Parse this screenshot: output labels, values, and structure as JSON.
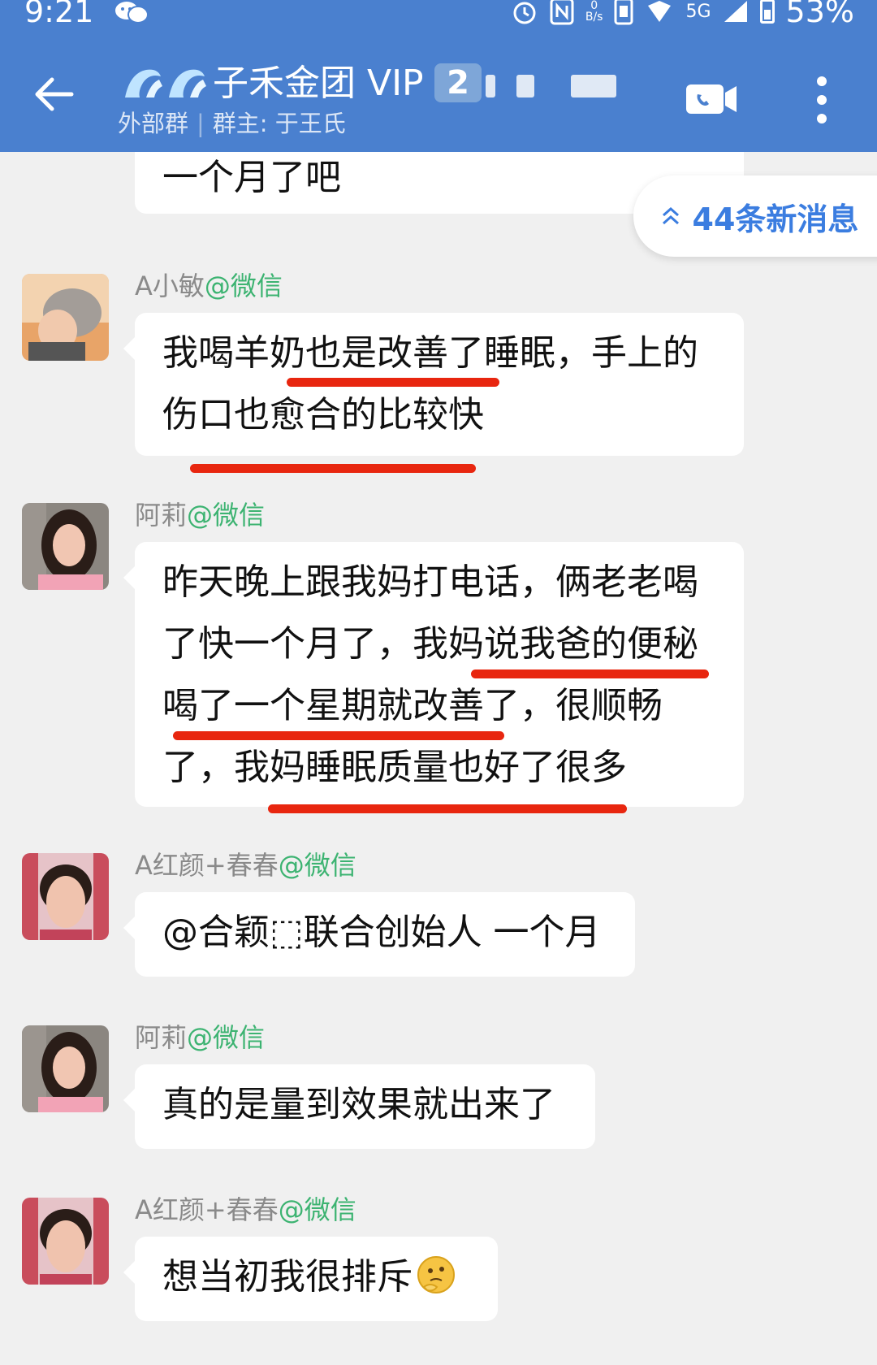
{
  "status_bar": {
    "time": "9:21",
    "net_speed_top": "0",
    "net_speed_unit": "B/s",
    "network": "5G",
    "battery": "53%",
    "icons": [
      "wechat-icon",
      "alarm-icon",
      "nfc-icon",
      "data-speed-icon",
      "signal-icon",
      "battery-icon"
    ]
  },
  "header": {
    "title": "子禾金团 VIP",
    "badge": "2",
    "group_type": "外部群",
    "owner": "群主: 于王氏",
    "accent": "#4a80cf"
  },
  "chat": {
    "new_messages": "44条新消息",
    "previous_message": {
      "text": "一个月了吧"
    },
    "messages": [
      {
        "sender": "A小敏",
        "source": "@微信",
        "lines": [
          "我喝羊奶也是改善了睡眠，手上的",
          "伤口也愈合的比较快"
        ]
      },
      {
        "sender": "阿莉",
        "source": "@微信",
        "lines": [
          "昨天晚上跟我妈打电话，俩老老喝",
          "了快一个月了，我妈说我爸的便秘",
          "喝了一个星期就改善了，很顺畅",
          "了，我妈睡眠质量也好了很多"
        ]
      },
      {
        "sender": "A红颜+春春",
        "source": "@微信",
        "lines": [
          "@合颖⬚联合创始人  一个月"
        ]
      },
      {
        "sender": "阿莉",
        "source": "@微信",
        "lines": [
          "真的是量到效果就出来了"
        ]
      },
      {
        "sender": "A红颜+春春",
        "source": "@微信",
        "lines": [
          "想当初我很排斥"
        ]
      }
    ],
    "highlight_color": "#e8260f",
    "source_color": "#3cb371",
    "new_message_color": "#3b7de0"
  }
}
